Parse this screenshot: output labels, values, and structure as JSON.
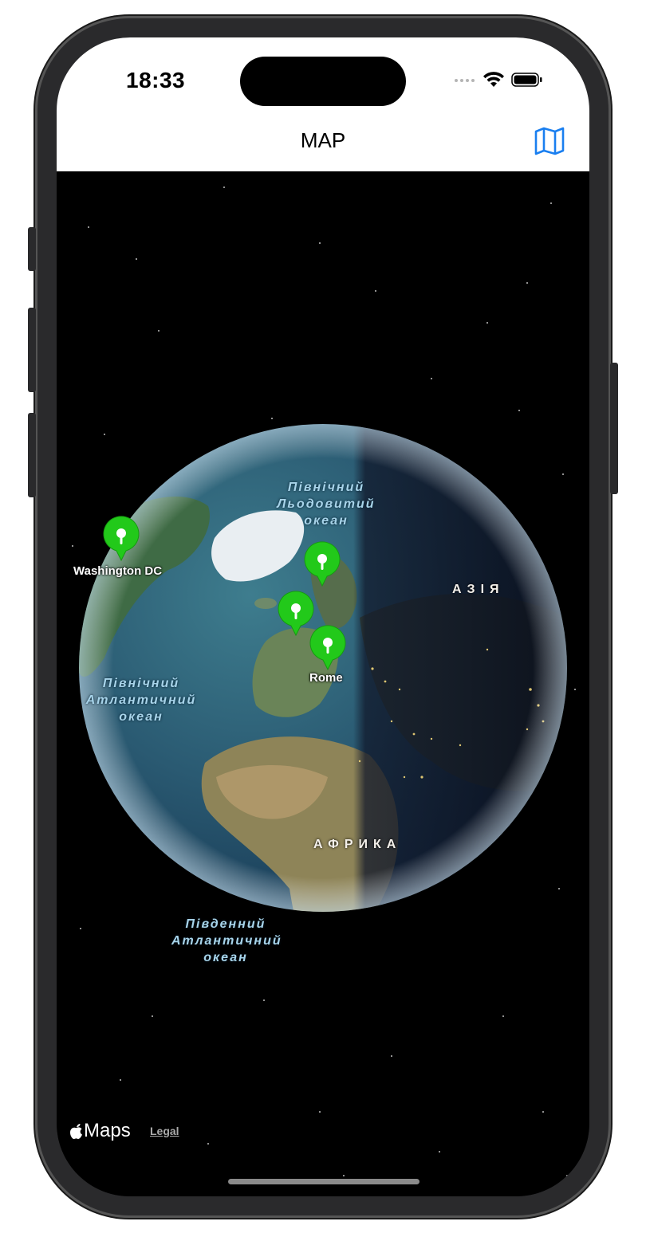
{
  "status_bar": {
    "time": "18:33"
  },
  "nav": {
    "title": "MAP",
    "map_icon": "map-icon"
  },
  "map": {
    "labels": {
      "arctic_ocean": "Північний Льодовитий океан",
      "north_atlantic": "Північний Атлантичний океан",
      "south_atlantic": "Південний Атлантичний океан",
      "asia": "АЗІЯ",
      "africa": "АФРИКА"
    },
    "pins": [
      {
        "label": "Washington DC"
      },
      {
        "label": ""
      },
      {
        "label": ""
      },
      {
        "label": "Rome"
      }
    ],
    "pin_color": "#22c91a"
  },
  "footer": {
    "maps_label": "Maps",
    "legal": "Legal"
  }
}
